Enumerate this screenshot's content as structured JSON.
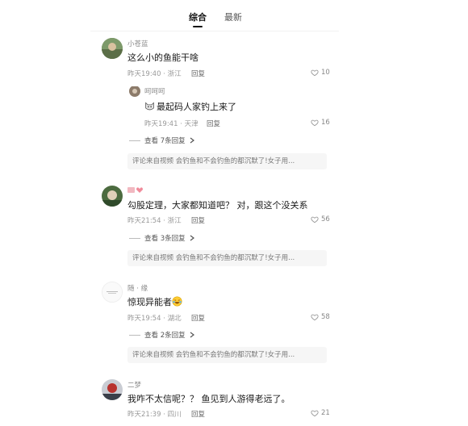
{
  "tabs": [
    {
      "label": "综合",
      "active": true
    },
    {
      "label": "最新",
      "active": false
    }
  ],
  "comments": [
    {
      "user": "小苍蓝",
      "text": "这么小的鱼能干啥",
      "time_location": "昨天19:40 · 浙江",
      "reply_label": "回复",
      "likes": "10",
      "sub_reply": {
        "user": "呵呵呵",
        "text": "最起码人家钓上来了",
        "time_location": "昨天19:41 · 天津",
        "reply_label": "回复",
        "likes": "16"
      },
      "expand": "查看 7条回复",
      "source": "评论来自视频  会钓鱼和不会钓鱼的都沉默了!女子用..."
    },
    {
      "user": "",
      "text": "勾股定理，大家都知道吧？ 对，跟这个没关系",
      "time_location": "昨天21:54 · 浙江",
      "reply_label": "回复",
      "likes": "56",
      "expand": "查看 3条回复",
      "source": "评论来自视频  会钓鱼和不会钓鱼的都沉默了!女子用..."
    },
    {
      "user": "随 · 缘",
      "text": "惊现异能者",
      "time_location": "昨天19:54 · 湖北",
      "reply_label": "回复",
      "likes": "58",
      "expand": "查看 2条回复",
      "source": "评论来自视频  会钓鱼和不会钓鱼的都沉默了!女子用..."
    },
    {
      "user": "二梦",
      "text": "我咋不太信呢？？ 鱼见到人游得老远了。",
      "time_location": "昨天21:39 · 四川",
      "reply_label": "回复",
      "likes": "21"
    }
  ],
  "icons": {
    "like": "heart-outline-icon",
    "expand": "chevron-right-icon",
    "emoji_cat": "cat-face-emoji",
    "emoji_laugh": "laughing-emoji"
  },
  "colors": {
    "accent": "#111111",
    "muted": "#999999",
    "source_bg": "#f6f6f6"
  }
}
